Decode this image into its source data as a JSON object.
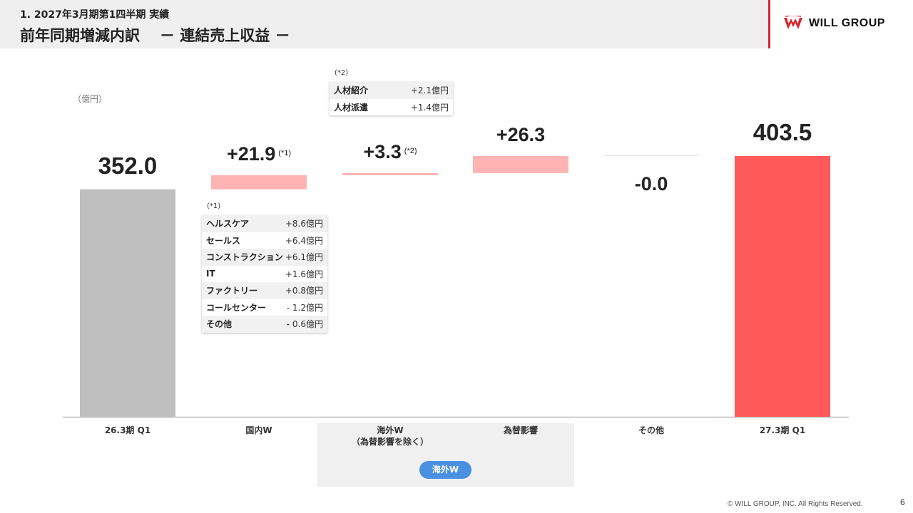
{
  "header": {
    "subtitle": "1. 2027年3月期第1四半期 実績",
    "title": "前年同期増減内訳",
    "title_suffix": "－ 連結売上収益 －"
  },
  "logo": {
    "text": "WILL GROUP"
  },
  "unit": "（億円）",
  "colors": {
    "start_bar": "#bfbfbf",
    "increase_bar": "#ffb3b3",
    "end_bar": "#ff5a5a",
    "accent_red": "#d9262c",
    "overseas_pill": "#4a90e2"
  },
  "chart_data": {
    "type": "bar",
    "subtype": "waterfall",
    "categories": [
      "26.3期 Q1",
      "国内W",
      "海外W（為替影響を除く）",
      "為替影響",
      "その他",
      "27.3期 Q1"
    ],
    "values": [
      352.0,
      21.9,
      3.3,
      26.3,
      -0.0,
      403.5
    ],
    "labels": [
      "352.0",
      "+21.9",
      "+3.3",
      "+26.3",
      "-0.0",
      "403.5"
    ],
    "measures": [
      "absolute",
      "relative",
      "relative",
      "relative",
      "relative",
      "total"
    ],
    "ylabel": "（億円）",
    "ylim": [
      0,
      420
    ],
    "grid": false
  },
  "bars": [
    {
      "label": "352.0",
      "category": "26.3期 Q1"
    },
    {
      "label": "+21.9",
      "note": "(*1)",
      "category": "国内W"
    },
    {
      "label": "+3.3",
      "note": "(*2)",
      "category": "海外W",
      "category_sub": "（為替影響を除く）"
    },
    {
      "label": "+26.3",
      "category": "為替影響"
    },
    {
      "label": "-0.0",
      "category": "その他"
    },
    {
      "label": "403.5",
      "category": "27.3期 Q1"
    }
  ],
  "overseas_group": {
    "label": "海外W"
  },
  "note1": {
    "title": "(*1)",
    "rows": [
      {
        "label": "ヘルスケア",
        "value": "+8.6億円"
      },
      {
        "label": "セールス",
        "value": "+6.4億円"
      },
      {
        "label": "コンストラクション",
        "value": "+6.1億円"
      },
      {
        "label": "IT",
        "value": "+1.6億円"
      },
      {
        "label": "ファクトリー",
        "value": "+0.8億円"
      },
      {
        "label": "コールセンター",
        "value": "- 1.2億円"
      },
      {
        "label": "その他",
        "value": "- 0.6億円"
      }
    ]
  },
  "note2": {
    "title": "(*2)",
    "rows": [
      {
        "label": "人材紹介",
        "value": "+2.1億円"
      },
      {
        "label": "人材派遣",
        "value": "+1.4億円"
      }
    ]
  },
  "footer": {
    "copyright": "© WILL GROUP, INC. All Rights Reserved.",
    "page": "6"
  }
}
